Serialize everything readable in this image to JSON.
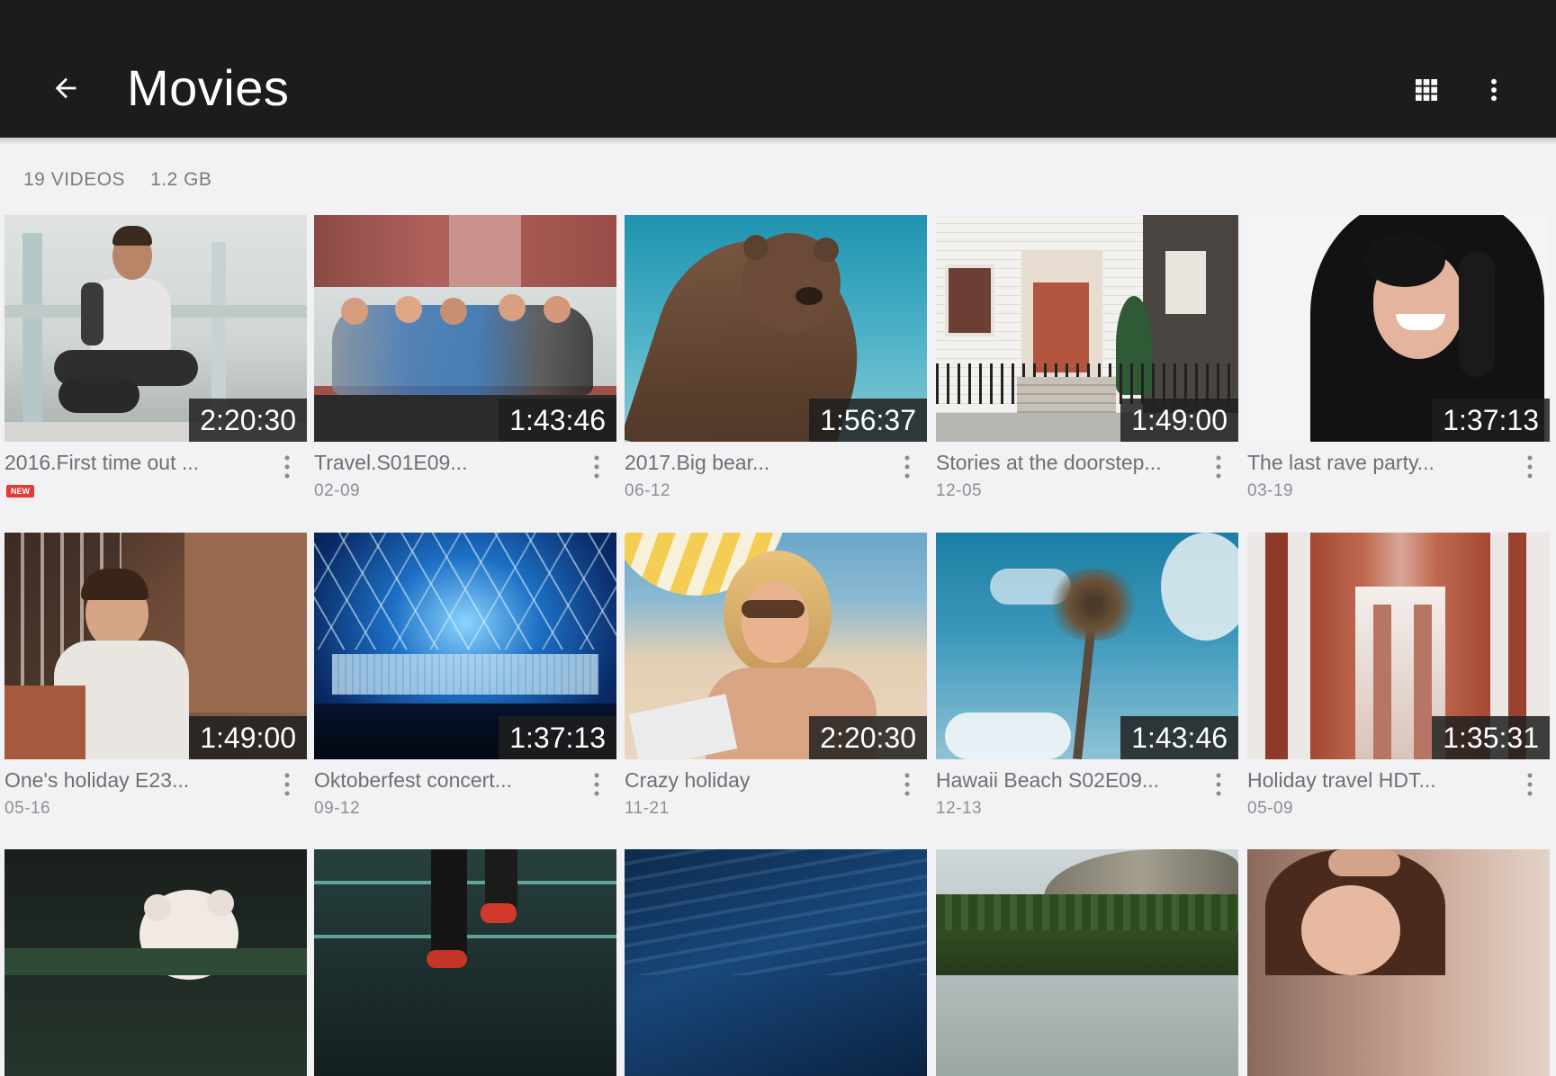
{
  "appbar": {
    "title": "Movies",
    "back_icon": "arrow-back-icon",
    "grid_icon": "grid-view-icon",
    "more_icon": "more-vert-icon"
  },
  "summary": {
    "count": "19 VIDEOS",
    "size": "1.2 GB"
  },
  "videos": [
    {
      "title": "2016.First time out ...",
      "date": "",
      "duration": "2:20:30",
      "badge": "NEW"
    },
    {
      "title": "Travel.S01E09...",
      "date": "02-09",
      "duration": "1:43:46"
    },
    {
      "title": "2017.Big bear...",
      "date": "06-12",
      "duration": "1:56:37"
    },
    {
      "title": "Stories at the doorstep...",
      "date": "12-05",
      "duration": "1:49:00"
    },
    {
      "title": "The last rave party...",
      "date": "03-19",
      "duration": "1:37:13"
    },
    {
      "title": "One's holiday E23...",
      "date": "05-16",
      "duration": "1:49:00"
    },
    {
      "title": "Oktoberfest concert...",
      "date": "09-12",
      "duration": "1:37:13"
    },
    {
      "title": "Crazy holiday",
      "date": "11-21",
      "duration": "2:20:30"
    },
    {
      "title": "Hawaii Beach S02E09...",
      "date": "12-13",
      "duration": "1:43:46"
    },
    {
      "title": "Holiday travel HDT...",
      "date": "05-09",
      "duration": "1:35:31"
    }
  ],
  "colors": {
    "appbar": "#1c1c1c",
    "background": "#f2f2f4",
    "new_badge": "#e53935"
  }
}
